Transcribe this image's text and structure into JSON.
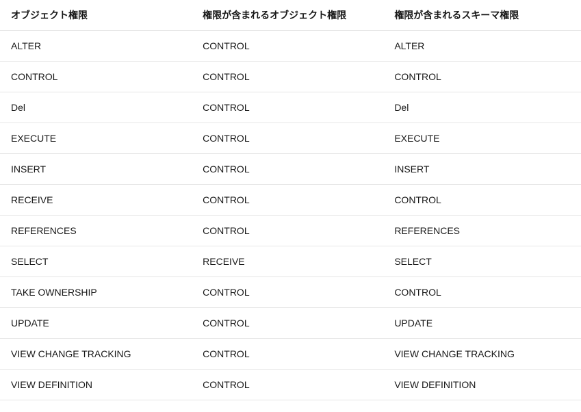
{
  "table": {
    "headers": [
      "オブジェクト権限",
      "権限が含まれるオブジェクト権限",
      "権限が含まれるスキーマ権限"
    ],
    "rows": [
      {
        "c0": "ALTER",
        "c1": "CONTROL",
        "c2": "ALTER"
      },
      {
        "c0": "CONTROL",
        "c1": "CONTROL",
        "c2": "CONTROL"
      },
      {
        "c0": "Del",
        "c1": "CONTROL",
        "c2": "Del"
      },
      {
        "c0": "EXECUTE",
        "c1": "CONTROL",
        "c2": "EXECUTE"
      },
      {
        "c0": "INSERT",
        "c1": "CONTROL",
        "c2": "INSERT"
      },
      {
        "c0": "RECEIVE",
        "c1": "CONTROL",
        "c2": "CONTROL"
      },
      {
        "c0": "REFERENCES",
        "c1": "CONTROL",
        "c2": "REFERENCES"
      },
      {
        "c0": "SELECT",
        "c1": "RECEIVE",
        "c2": "SELECT"
      },
      {
        "c0": "TAKE OWNERSHIP",
        "c1": "CONTROL",
        "c2": "CONTROL"
      },
      {
        "c0": "UPDATE",
        "c1": "CONTROL",
        "c2": "UPDATE"
      },
      {
        "c0": "VIEW CHANGE TRACKING",
        "c1": "CONTROL",
        "c2": "VIEW CHANGE TRACKING"
      },
      {
        "c0": "VIEW DEFINITION",
        "c1": "CONTROL",
        "c2": "VIEW DEFINITION"
      }
    ]
  }
}
